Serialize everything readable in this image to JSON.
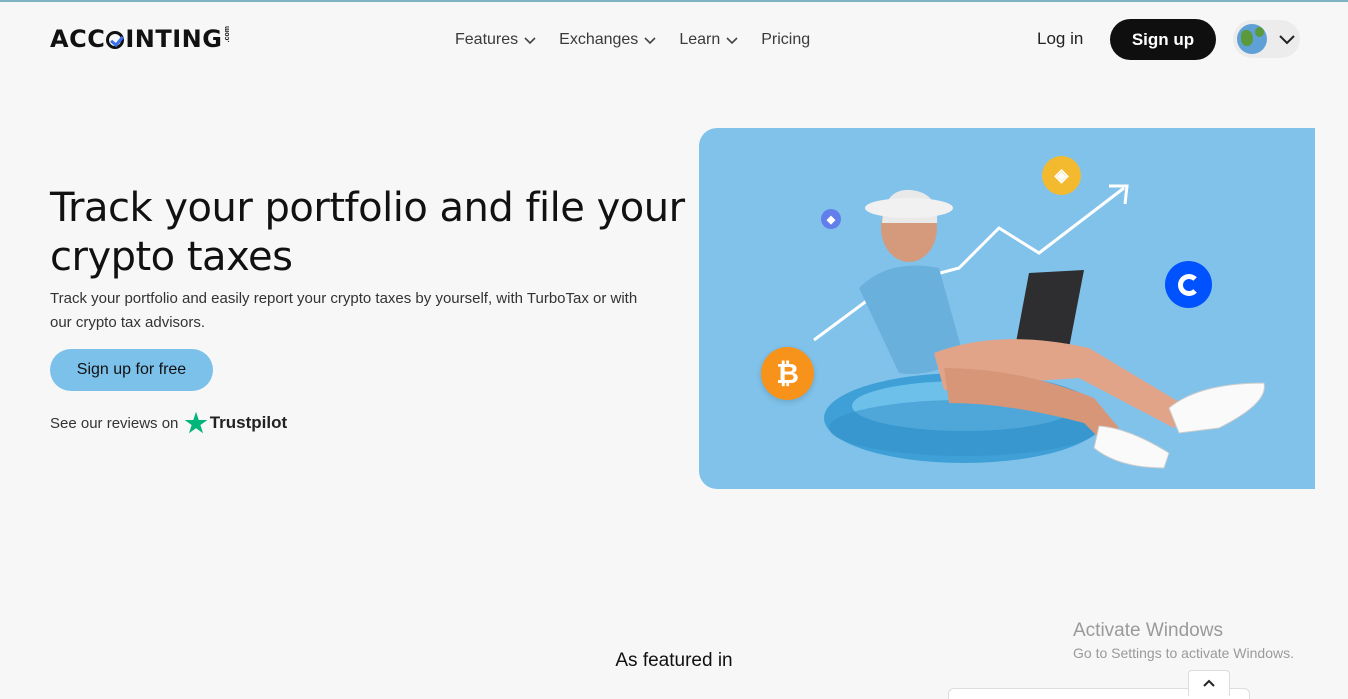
{
  "brand": {
    "logo_left": "ACC",
    "logo_right": "INTING",
    "logo_com": ".com"
  },
  "nav": {
    "items": [
      {
        "label": "Features",
        "has_dropdown": true
      },
      {
        "label": "Exchanges",
        "has_dropdown": true
      },
      {
        "label": "Learn",
        "has_dropdown": true
      },
      {
        "label": "Pricing",
        "has_dropdown": false
      }
    ]
  },
  "header": {
    "login_label": "Log in",
    "signup_label": "Sign up",
    "language_icon": "globe-icon"
  },
  "hero": {
    "title": "Track your portfolio and file your crypto taxes",
    "subtitle": "Track your portfolio and easily report your crypto taxes by yourself, with TurboTax or with our crypto tax advisors.",
    "cta_label": "Sign up for free",
    "reviews_text": "See our reviews on",
    "trustpilot_label": "Trustpilot"
  },
  "hero_image": {
    "coins": [
      "bitcoin-icon",
      "binance-icon",
      "ethereum-icon",
      "coinbase-icon"
    ],
    "background": "#80c2ea"
  },
  "featured": {
    "heading": "As featured in"
  },
  "watermark": {
    "line1": "Activate Windows",
    "line2": "Go to Settings to activate Windows."
  },
  "colors": {
    "accent": "#7cc1ea",
    "dark": "#0f0f0f",
    "trustpilot": "#00b67a"
  }
}
